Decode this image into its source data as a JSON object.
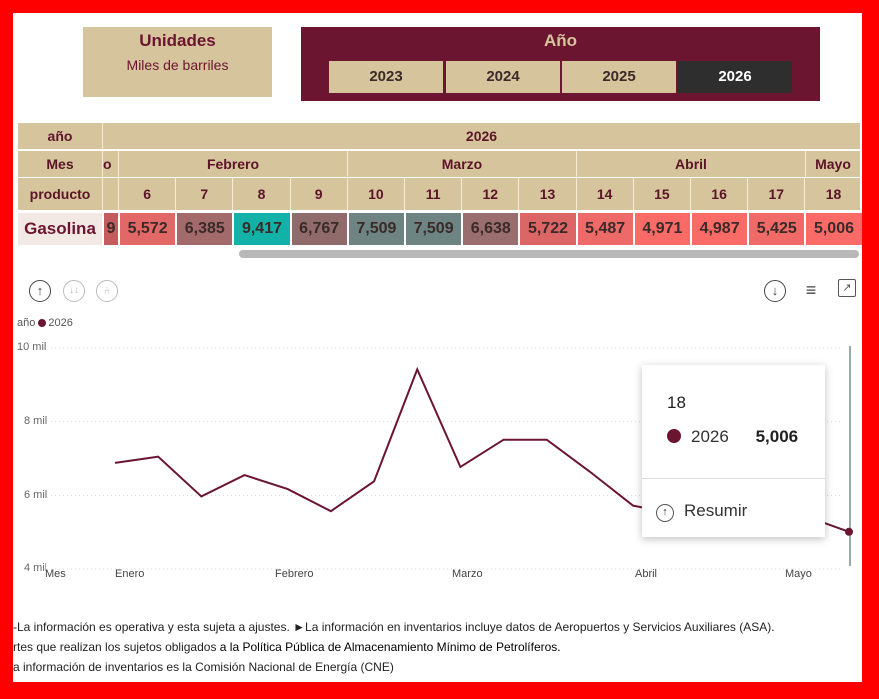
{
  "units": {
    "title": "Unidades",
    "subtitle": "Miles de barriles"
  },
  "year_selector": {
    "label": "Año",
    "options": [
      "2023",
      "2024",
      "2025",
      "2026"
    ],
    "selected": "2026"
  },
  "matrix": {
    "row_labels": {
      "year": "año",
      "month": "Mes",
      "product": "producto"
    },
    "year": "2026",
    "months": [
      {
        "label": "o"
      },
      {
        "label": "Febrero"
      },
      {
        "label": "Marzo"
      },
      {
        "label": "Abril"
      },
      {
        "label": "Mayo"
      }
    ],
    "product_label": "Gasolina",
    "columns": [
      {
        "day": "",
        "value": "9",
        "color": "#c65b5e"
      },
      {
        "day": "6",
        "value": "5,572",
        "color": "#e26867"
      },
      {
        "day": "7",
        "value": "6,385",
        "color": "#a36a6c"
      },
      {
        "day": "8",
        "value": "9,417",
        "color": "#12b2a8"
      },
      {
        "day": "9",
        "value": "6,767",
        "color": "#8f6b6c"
      },
      {
        "day": "10",
        "value": "7,509",
        "color": "#6d8483"
      },
      {
        "day": "11",
        "value": "7,509",
        "color": "#6d8483"
      },
      {
        "day": "12",
        "value": "6,638",
        "color": "#9a6d6e"
      },
      {
        "day": "13",
        "value": "5,722",
        "color": "#dc6566"
      },
      {
        "day": "14",
        "value": "5,487",
        "color": "#ee6a68"
      },
      {
        "day": "15",
        "value": "4,971",
        "color": "#fa6b68"
      },
      {
        "day": "16",
        "value": "4,987",
        "color": "#fa6b68"
      },
      {
        "day": "17",
        "value": "5,425",
        "color": "#f06a68"
      },
      {
        "day": "18",
        "value": "5,006",
        "color": "#fa6b68"
      }
    ]
  },
  "toolbar": {
    "icons": [
      "drill-up-icon",
      "drill-down-all-icon",
      "expand-hierarchy-icon",
      "download-icon",
      "filter-icon",
      "focus-mode-icon"
    ]
  },
  "legend": {
    "title": "año",
    "series": "2026"
  },
  "chart_data": {
    "type": "line",
    "legend_title": "año",
    "series": [
      {
        "name": "2026",
        "color": "#6b1530",
        "values": [
          6.88,
          7.05,
          5.97,
          6.55,
          6.17,
          5.57,
          6.38,
          9.42,
          6.77,
          7.51,
          7.51,
          6.64,
          5.72,
          5.49,
          4.97,
          4.99,
          5.43,
          5.01
        ]
      }
    ],
    "y_ticks": [
      {
        "value": 10,
        "label": "10 mil"
      },
      {
        "value": 8,
        "label": "8 mil"
      },
      {
        "value": 6,
        "label": "6 mil"
      },
      {
        "value": 4,
        "label": "4 mil"
      }
    ],
    "ylim": [
      4,
      10
    ],
    "xlabel": "Mes",
    "x_month_labels": [
      "Enero",
      "Febrero",
      "Marzo",
      "Abril",
      "Mayo"
    ]
  },
  "tooltip": {
    "day": "18",
    "series": "2026",
    "value": "5,006",
    "action": "Resumir"
  },
  "footer": {
    "line1": "-La información es operativa y esta sujeta a ajustes. ►La información en inventarios incluye datos de Aeropuertos y Servicios Auxiliares (ASA).",
    "line2a": "rtes que realizan los sujetos obligados ",
    "line2b": "a la Política Pública de Almacenamiento Mínimo de Petrolíferos.",
    "line3": "a información de inventarios es la Comisión Nacional de Energía (CNE)"
  }
}
